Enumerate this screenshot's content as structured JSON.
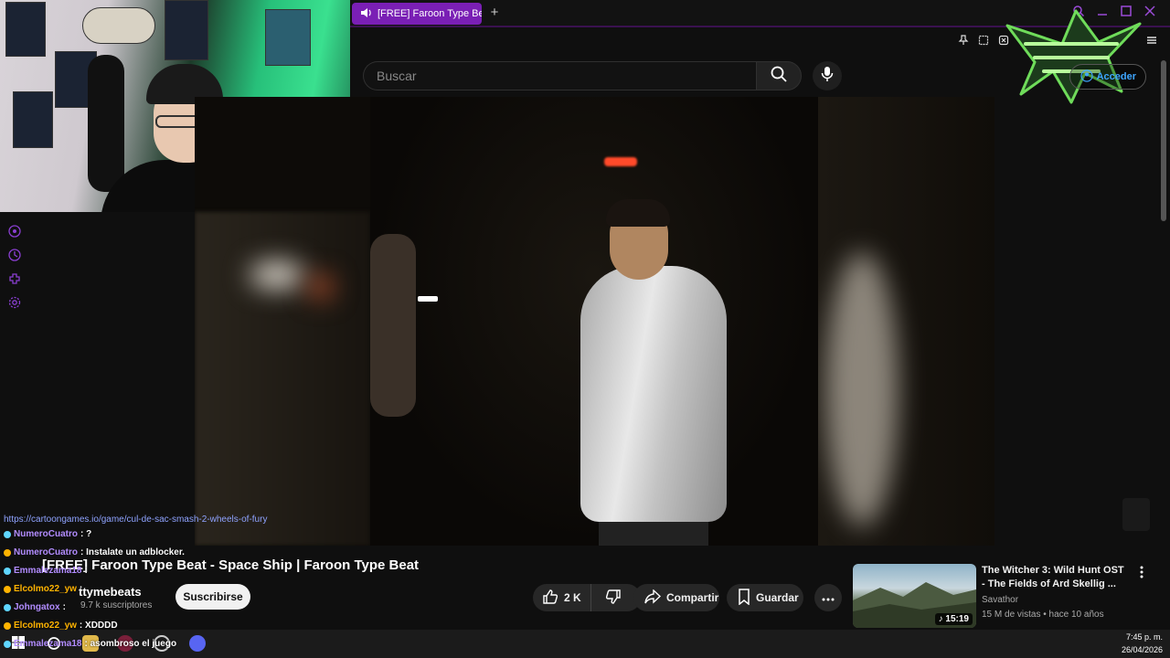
{
  "browser": {
    "tab_title": "[FREE] Faroon Type Be",
    "new_tab": "+"
  },
  "search": {
    "placeholder": "Buscar"
  },
  "header": {
    "access_label": "Acceder"
  },
  "video": {
    "title": "[FREE] Faroon Type Beat - Space Ship | Faroon Type Beat"
  },
  "channel": {
    "name": "ttymebeats",
    "subscribers": "9.7 k suscriptores",
    "subscribe_label": "Suscribirse"
  },
  "actions": {
    "likes": "2 K",
    "share_label": "Compartir",
    "save_label": "Guardar"
  },
  "recommended": {
    "title": "The Witcher 3: Wild Hunt OST - The Fields of Ard Skellig ...",
    "channel": "Savathor",
    "meta": "15 M de vistas • hace 10 años",
    "duration": "15:19"
  },
  "chat": {
    "url": "https://cartoongames.io/game/cul-de-sac-smash-2-wheels-of-fury",
    "lines": [
      {
        "user": "NumeroCuatro",
        "msg": ": ?",
        "color": "#b28cff"
      },
      {
        "user": "NumeroCuatro",
        "msg": ": Instalate un adblocker.",
        "color": "#b28cff"
      },
      {
        "user": "Emmalezama18",
        "msg": ":",
        "color": "#b28cff"
      },
      {
        "user": "Elcolmo22_yw",
        "msg": ":",
        "color": "#ffb300"
      },
      {
        "user": "Johngatox",
        "msg": ":",
        "color": "#b28cff"
      },
      {
        "user": "Elcolmo22_yw",
        "msg": ": XDDDD",
        "color": "#ffb300"
      },
      {
        "user": "Emmalezama18",
        "msg": ": asombroso el juego",
        "color": "#b28cff"
      }
    ]
  },
  "clock": {
    "time": "7:45 p. m.",
    "date": "26/04/2026"
  },
  "colors": {
    "accent": "#7a1fb5",
    "chat_purple": "#b28cff",
    "chat_gold": "#ffb300"
  }
}
